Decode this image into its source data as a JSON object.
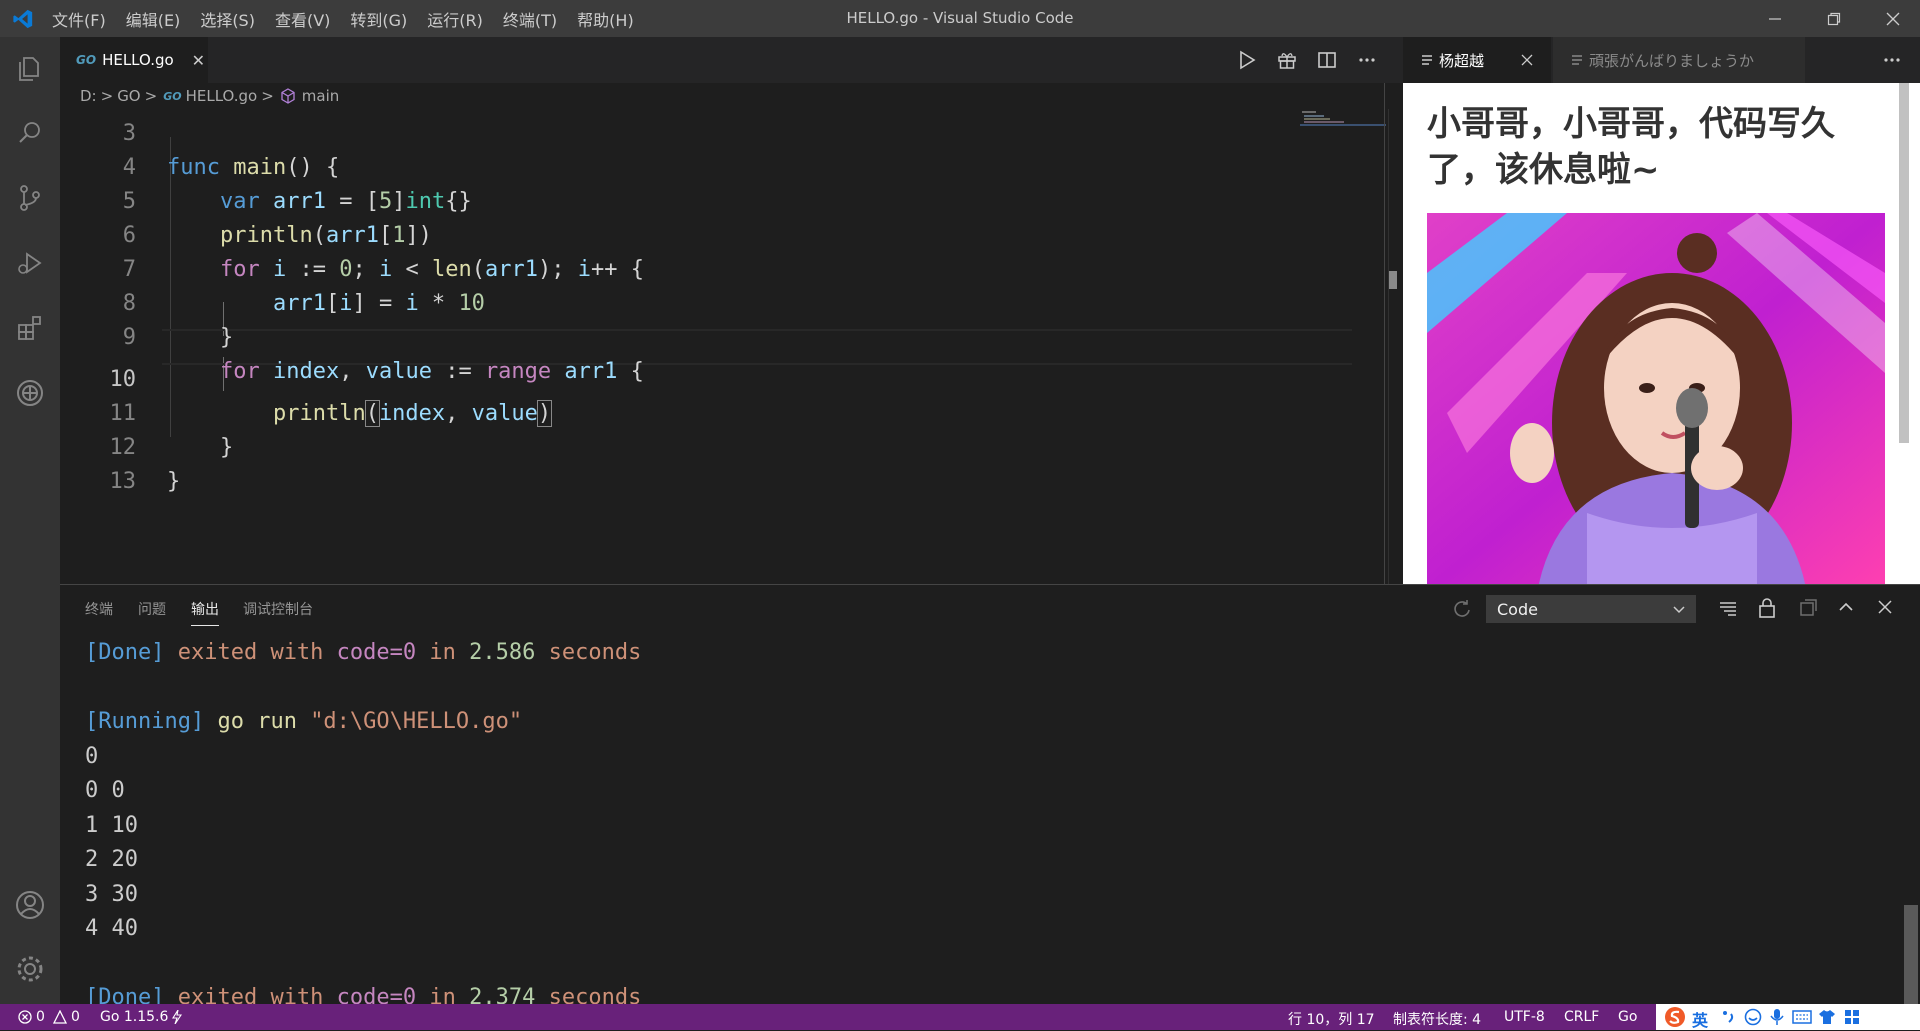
{
  "window": {
    "title": "HELLO.go - Visual Studio Code",
    "menu": [
      "文件(F)",
      "编辑(E)",
      "选择(S)",
      "查看(V)",
      "转到(G)",
      "运行(R)",
      "终端(T)",
      "帮助(H)"
    ]
  },
  "activity_bar": {
    "icons": [
      "files-icon",
      "search-icon",
      "source-control-icon",
      "run-debug-icon",
      "extensions-icon",
      "remote-explorer-icon",
      "account-icon",
      "settings-gear-icon"
    ]
  },
  "editor": {
    "tab": {
      "icon_text": "GO",
      "label": "HELLO.go",
      "close": "✕"
    },
    "breadcrumb": {
      "drive": "D:",
      "folder": "GO",
      "file": "HELLO.go",
      "symbol": "main",
      "sep": ">"
    },
    "lines": [
      {
        "num": "3",
        "text": "func main() {"
      },
      {
        "num": "4",
        "text": "    var arr1 = [5]int{}"
      },
      {
        "num": "5",
        "text": "    println(arr1[1])"
      },
      {
        "num": "6",
        "text": "    for i := 0; i < len(arr1); i++ {"
      },
      {
        "num": "7",
        "text": "        arr1[i] = i * 10"
      },
      {
        "num": "8",
        "text": "    }"
      },
      {
        "num": "9",
        "text": "    for index, value := range arr1 {"
      },
      {
        "num": "10",
        "text": "        println(index, value)"
      },
      {
        "num": "11",
        "text": "    }"
      },
      {
        "num": "12",
        "text": "}"
      },
      {
        "num": "13",
        "text": ""
      }
    ],
    "current_line": "10"
  },
  "right_panel": {
    "tab_active": "杨超越",
    "tab_inactive": "頑張がんばりましょうか",
    "headline": "小哥哥，小哥哥，代码写久了，该休息啦~"
  },
  "panel": {
    "tabs": [
      "终端",
      "问题",
      "输出",
      "调试控制台"
    ],
    "active_tab": "输出",
    "output_channel": "Code",
    "output": [
      {
        "parts": [
          [
            "o-blue",
            "[Done]"
          ],
          [
            "o-orange",
            " exited with "
          ],
          [
            "o-purple",
            "code=0"
          ],
          [
            "o-orange",
            " in "
          ],
          [
            "o-green",
            "2.586"
          ],
          [
            "o-orange",
            " seconds"
          ]
        ]
      },
      {
        "parts": []
      },
      {
        "parts": [
          [
            "o-blue",
            "[Running]"
          ],
          [
            "o-yellow",
            " go run "
          ],
          [
            "o-orange",
            "\"d:\\GO\\HELLO.go\""
          ]
        ]
      },
      {
        "parts": [
          [
            "",
            "0"
          ]
        ]
      },
      {
        "parts": [
          [
            "",
            "0 0"
          ]
        ]
      },
      {
        "parts": [
          [
            "",
            "1 10"
          ]
        ]
      },
      {
        "parts": [
          [
            "",
            "2 20"
          ]
        ]
      },
      {
        "parts": [
          [
            "",
            "3 30"
          ]
        ]
      },
      {
        "parts": [
          [
            "",
            "4 40"
          ]
        ]
      },
      {
        "parts": []
      },
      {
        "parts": [
          [
            "o-blue",
            "[Done]"
          ],
          [
            "o-orange",
            " exited with "
          ],
          [
            "o-purple",
            "code=0"
          ],
          [
            "o-orange",
            " in "
          ],
          [
            "o-green",
            "2.374"
          ],
          [
            "o-orange",
            " seconds"
          ]
        ]
      }
    ]
  },
  "status_bar": {
    "errors": "0",
    "warnings": "0",
    "go_version": "Go 1.15.6",
    "position": "行 10，列 17",
    "tab_size": "制表符长度: 4",
    "encoding": "UTF-8",
    "eol": "CRLF",
    "language": "Go",
    "ime": "英"
  },
  "colors": {
    "status_bar": "#68217a",
    "activity_bar": "#333333",
    "editor_bg": "#1e1e1e",
    "keyword": "#569cd6"
  }
}
